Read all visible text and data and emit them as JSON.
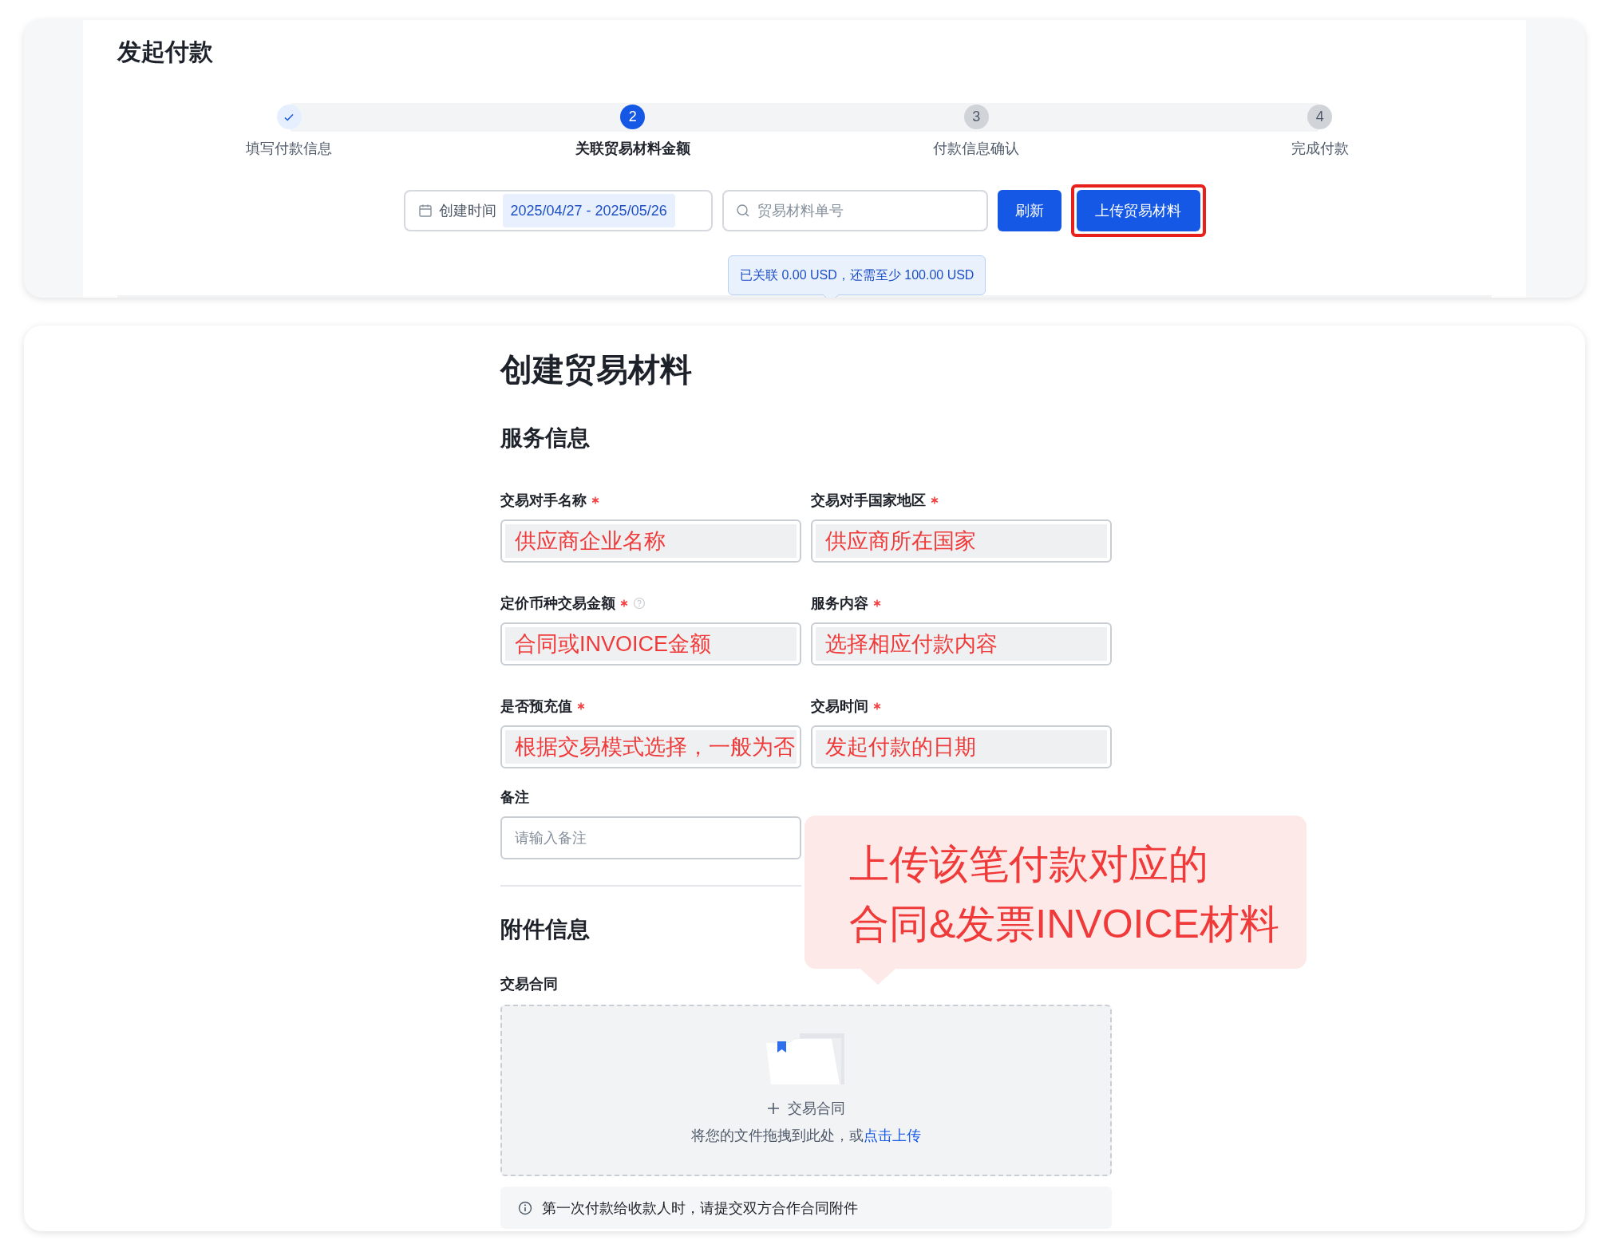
{
  "page_title": "发起付款",
  "steps": [
    {
      "label": "填写付款信息",
      "completed": true,
      "selected": false
    },
    {
      "label": "关联贸易材料金额",
      "number": "2",
      "completed": false,
      "selected": true
    },
    {
      "label": "付款信息确认",
      "number": "3",
      "completed": false,
      "selected": false
    },
    {
      "label": "完成付款",
      "number": "4",
      "completed": false,
      "selected": false
    }
  ],
  "filter": {
    "date_label": "创建时间",
    "date_range": "2025/04/27 - 2025/05/26",
    "search_placeholder": "贸易材料单号",
    "refresh_button": "刷新",
    "upload_button": "上传贸易材料",
    "upload_highlighted": true
  },
  "tooltip": "已关联 0.00 USD，还需至少 100.00 USD",
  "form": {
    "title": "创建贸易材料",
    "section": "服务信息",
    "fields": [
      {
        "label": "交易对手名称",
        "required": true,
        "help": false,
        "value": "供应商企业名称"
      },
      {
        "label": "交易对手国家地区",
        "required": true,
        "help": false,
        "value": "供应商所在国家"
      },
      {
        "label": "定价币种交易金额",
        "required": true,
        "help": true,
        "value": "合同或INVOICE金额"
      },
      {
        "label": "服务内容",
        "required": true,
        "help": false,
        "value": "选择相应付款内容"
      },
      {
        "label": "是否预充值",
        "required": true,
        "help": false,
        "value": "根据交易模式选择，一般为否"
      },
      {
        "label": "交易时间",
        "required": true,
        "help": false,
        "value": "发起付款的日期"
      }
    ],
    "remark": {
      "label": "备注",
      "placeholder": "请输入备注"
    },
    "attachments": {
      "title": "附件信息",
      "contract_label": "交易合同",
      "upload_title": "交易合同",
      "upload_hint": "将您的文件拖拽到此处，或",
      "upload_link": "点击上传",
      "notice": "第一次付款给收款人时，请提交双方合作合同附件"
    }
  },
  "callout": {
    "lines": [
      "上传该笔付款对应的",
      "合同&发票INVOICE材料"
    ]
  }
}
